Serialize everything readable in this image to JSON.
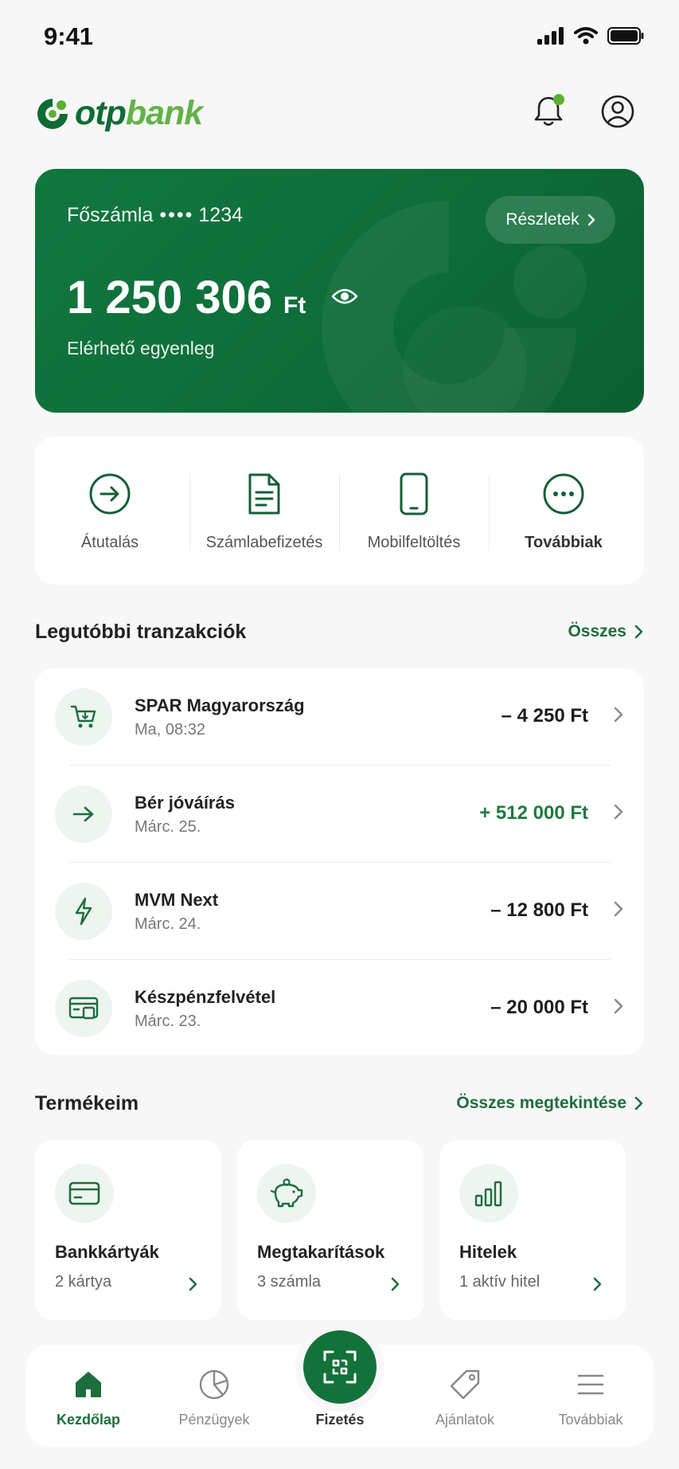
{
  "status_bar": {
    "time": "9:41"
  },
  "brand": {
    "logo_primary": "otp",
    "logo_secondary": "bank",
    "primary_color": "#0f6b33",
    "accent_color": "#5ab031"
  },
  "header": {
    "notification_icon": "bell-icon",
    "profile_icon": "user-circle-icon"
  },
  "account": {
    "name": "Főszámla",
    "mask": "••••",
    "last_digits": "1234",
    "details_label": "Részletek",
    "balance": "1 250 306",
    "currency": "Ft",
    "balance_label": "Elérhető egyenleg"
  },
  "quick_actions": [
    {
      "label": "Átutalás",
      "icon": "arrow-right-circle-icon"
    },
    {
      "label": "Számlabefizetés",
      "icon": "document-icon"
    },
    {
      "label": "Mobilfeltöltés",
      "icon": "phone-icon"
    },
    {
      "label": "Továbbiak",
      "icon": "more-circle-icon"
    }
  ],
  "transactions": {
    "title": "Legutóbbi tranzakciók",
    "link": "Összes",
    "items": [
      {
        "name": "SPAR Magyarország",
        "date": "Ma, 08:32",
        "amount": "– 4 250 Ft",
        "icon": "cart-icon",
        "positive": false
      },
      {
        "name": "Bér jóváírás",
        "date": "Márc. 25.",
        "amount": "+ 512 000 Ft",
        "icon": "arrow-right-icon",
        "positive": true
      },
      {
        "name": "MVM Next",
        "date": "Márc. 24.",
        "amount": "– 12 800 Ft",
        "icon": "lightning-icon",
        "positive": false
      },
      {
        "name": "Készpénzfelvétel",
        "date": "Márc. 23.",
        "amount": "– 20 000 Ft",
        "icon": "cash-icon",
        "positive": false
      }
    ]
  },
  "products": {
    "title": "Termékeim",
    "link": "Összes megtekintése",
    "items": [
      {
        "name": "Bankkártyák",
        "sub": "2 kártya",
        "icon": "credit-card-icon"
      },
      {
        "name": "Megtakarítások",
        "sub": "3 számla",
        "icon": "piggy-bank-icon"
      },
      {
        "name": "Hitelek",
        "sub": "1 aktív hitel",
        "icon": "bar-chart-icon"
      }
    ]
  },
  "bottom_nav": {
    "items": [
      {
        "label": "Kezdőlap",
        "icon": "home-icon",
        "active": true
      },
      {
        "label": "Pénzügyek",
        "icon": "pie-chart-icon",
        "active": false
      },
      {
        "label": "Ajánlatok",
        "icon": "tag-icon",
        "active": false
      },
      {
        "label": "Továbbiak",
        "icon": "menu-icon",
        "active": false
      }
    ],
    "center": {
      "label": "Fizetés",
      "icon": "qr-scan-icon"
    }
  }
}
